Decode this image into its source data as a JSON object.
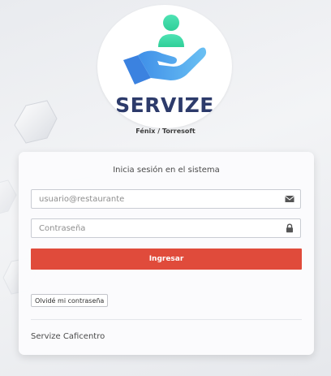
{
  "brand": {
    "logo_text": "SERVIZE",
    "subtitle": "Fénix / Torresoft"
  },
  "login": {
    "title": "Inicia sesión en el sistema",
    "username_placeholder": "usuario@restaurante",
    "username_icon": "envelope-icon",
    "password_placeholder": "Contraseña",
    "password_icon": "lock-icon",
    "submit_label": "Ingresar",
    "forgot_label": "Olvidé mi contraseña",
    "footer": "Servize Caficentro"
  },
  "colors": {
    "primary_button": "#e04b3b",
    "logo_text": "#2d3b6b",
    "logo_person": "#3fd9a6",
    "logo_hand": "#4fa3ee"
  }
}
